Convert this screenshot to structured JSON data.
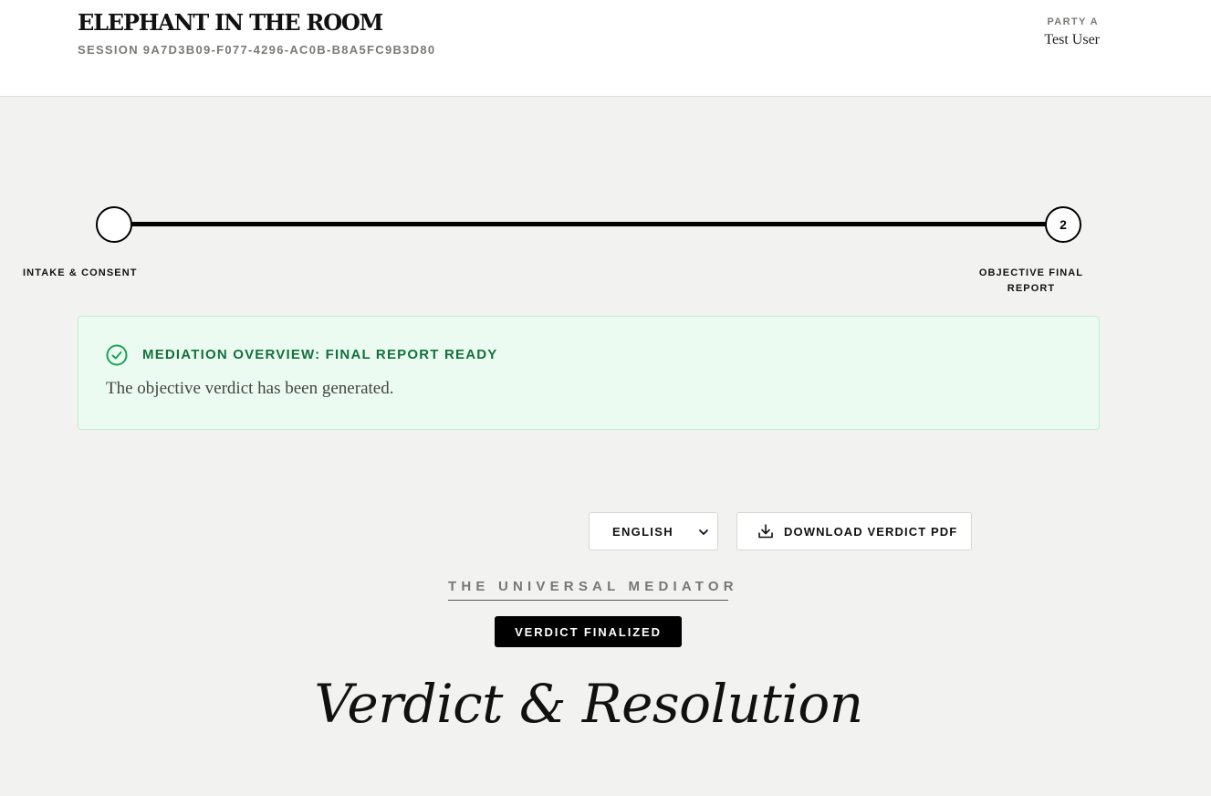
{
  "header": {
    "brand": "ELEPHANT IN THE ROOM",
    "session": "SESSION 9A7D3B09-F077-4296-AC0B-B8A5FC9B3D80",
    "party_label": "PARTY A",
    "party_name": "Test User"
  },
  "progress": {
    "steps": [
      {
        "number": "",
        "label": "INTAKE & CONSENT"
      },
      {
        "number": "2",
        "label": "OBJECTIVE FINAL REPORT"
      }
    ]
  },
  "alert": {
    "icon": "check-circle-icon",
    "title": "MEDIATION OVERVIEW: FINAL REPORT READY",
    "text": "The objective verdict has been generated.",
    "color": "#12703f",
    "background": "#ecfbf1"
  },
  "toolbar": {
    "language_selected": "ENGLISH",
    "download_label": "DOWNLOAD VERDICT PDF",
    "download_icon": "download-icon"
  },
  "verdict": {
    "overline": "THE UNIVERSAL MEDIATOR",
    "badge": "VERDICT FINALIZED",
    "title": "Verdict & Resolution"
  }
}
